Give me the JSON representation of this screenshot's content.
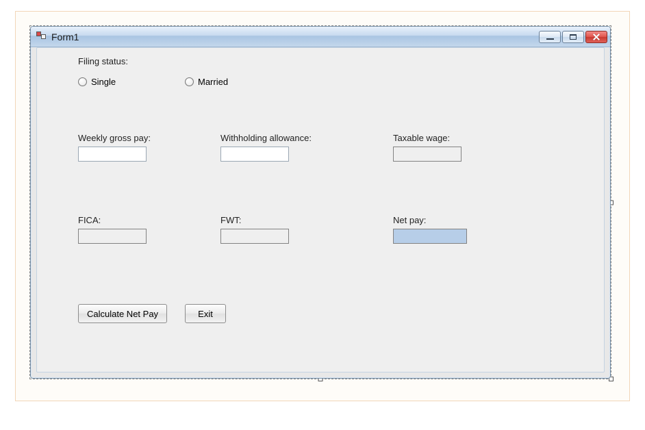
{
  "window": {
    "title": "Form1"
  },
  "labels": {
    "filing_status": "Filing status:",
    "single": "Single",
    "married": "Married",
    "weekly_gross_pay": "Weekly gross pay:",
    "withholding_allowance": "Withholding allowance:",
    "taxable_wage": "Taxable wage:",
    "fica": "FICA:",
    "fwt": "FWT:",
    "net_pay": "Net pay:"
  },
  "buttons": {
    "calculate": "Calculate Net Pay",
    "exit": "Exit"
  },
  "values": {
    "weekly_gross_pay": "",
    "withholding_allowance": "",
    "taxable_wage": "",
    "fica": "",
    "fwt": "",
    "net_pay": ""
  }
}
